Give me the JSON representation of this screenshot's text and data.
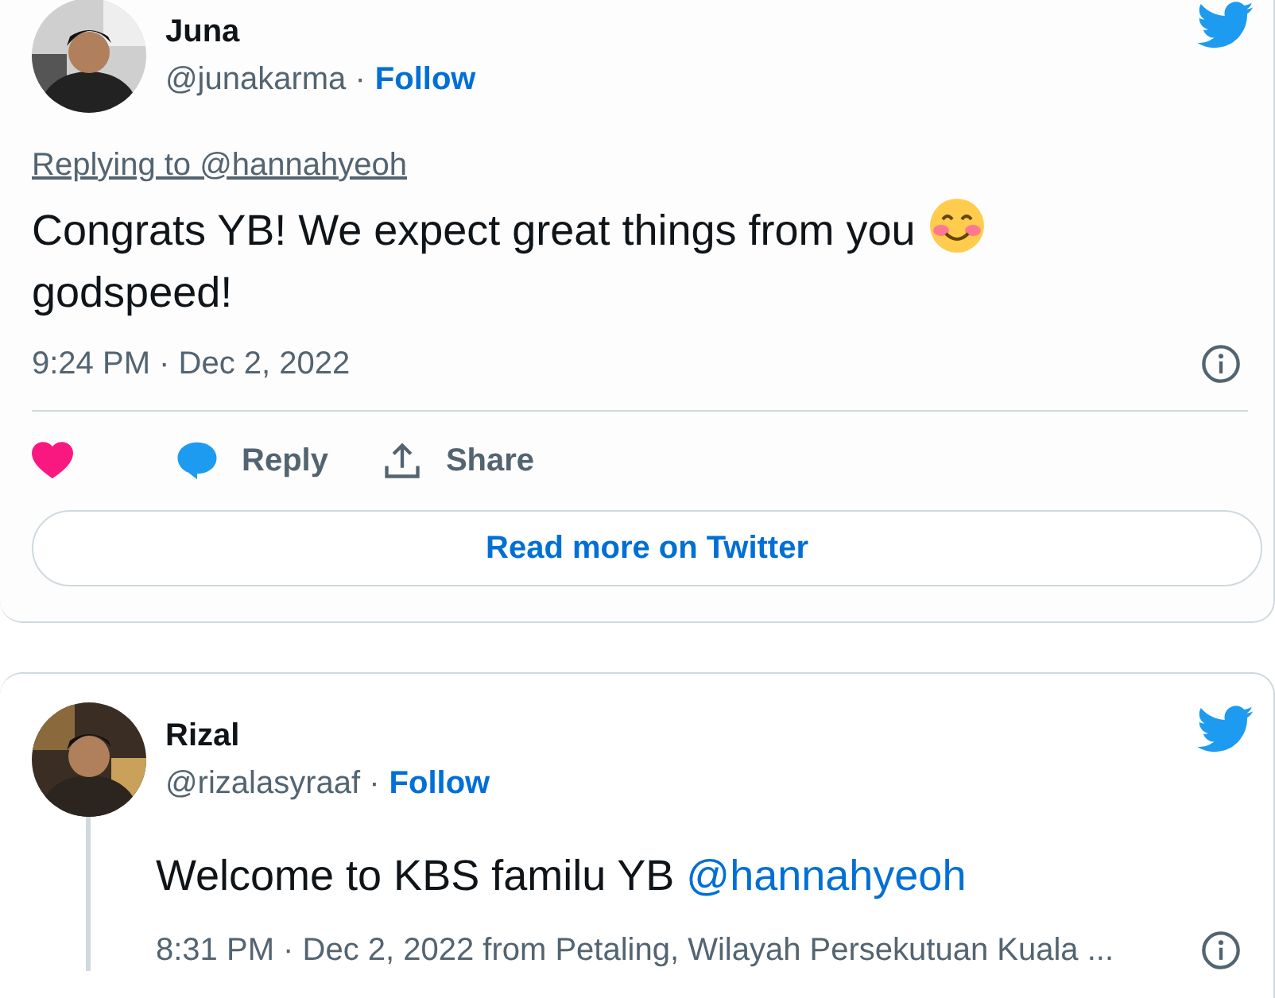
{
  "tweets": [
    {
      "name": "Juna",
      "handle": "@junakarma ·",
      "follow": "Follow",
      "replying_to": "Replying to @hannahyeoh",
      "text": "Congrats YB! We expect great things from you",
      "text_after_emoji": "godspeed!",
      "meta": "9:24 PM · Dec 2, 2022",
      "liked": true,
      "actions": [
        {
          "kind": "reply",
          "label": "Reply"
        },
        {
          "kind": "share",
          "label": "Share"
        }
      ],
      "read_more": "Read more on Twitter"
    },
    {
      "name": "Rizal",
      "handle": "@rizalasyraaf ·",
      "follow": "Follow",
      "text": "Welcome to KBS familu YB",
      "mention": "@hannahyeoh",
      "meta": "8:31 PM · Dec 2, 2022 from Petaling, Wilayah Persekutuan Kuala ..."
    }
  ]
}
